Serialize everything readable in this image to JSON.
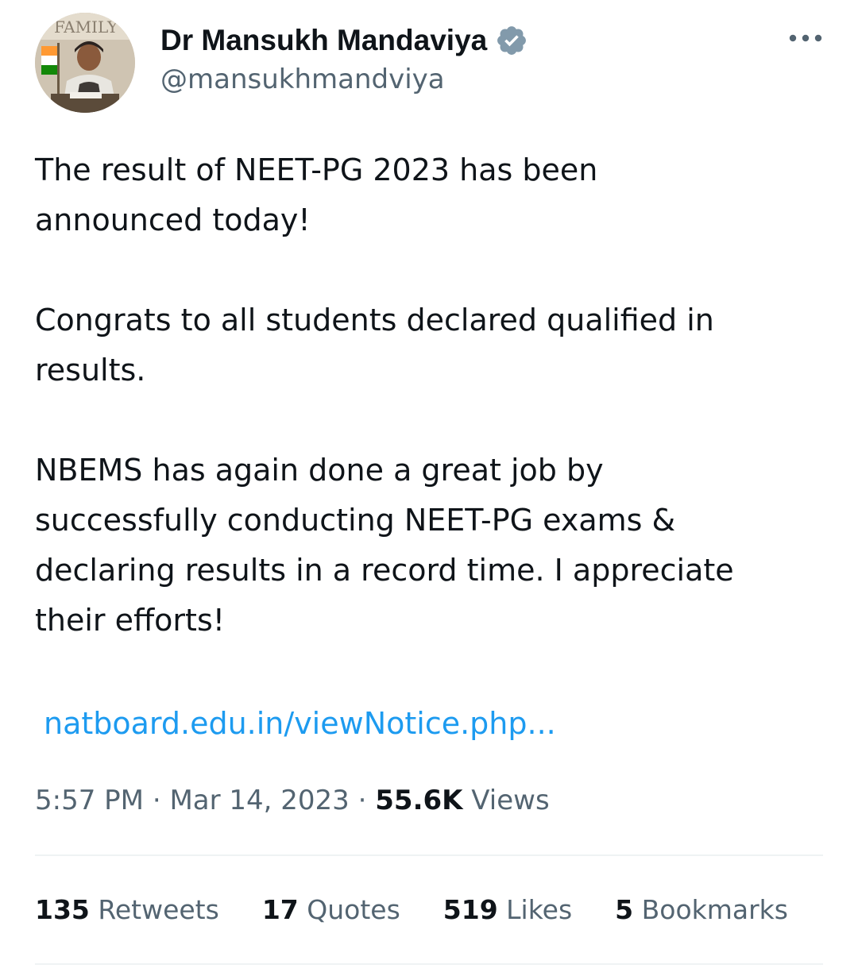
{
  "author": {
    "avatar_icon": "profile-photo",
    "avatar_text": "FAMILY",
    "display_name": "Dr Mansukh Mandaviya",
    "verified_icon": "verified-badge-icon",
    "handle": "@mansukhmandviya"
  },
  "menu": {
    "more_icon": "more-options-icon"
  },
  "tweet": {
    "paragraphs": [
      {
        "lines": [
          "The result of NEET-PG 2023 has been",
          "announced today!"
        ]
      },
      {
        "lines": [
          "Congrats to all students declared qualified in",
          "results."
        ]
      },
      {
        "lines": [
          "NBEMS has again done a great job by",
          "successfully conducting NEET-PG exams &",
          "declaring results in a record time. I appreciate",
          "their efforts!"
        ]
      }
    ],
    "link": "natboard.edu.in/viewNotice.php..."
  },
  "meta": {
    "time": "5:57 PM",
    "separator": "·",
    "date": "Mar 14, 2023",
    "views_count": "55.6K",
    "views_label": "Views"
  },
  "stats": [
    {
      "count": "135",
      "label": "Retweets"
    },
    {
      "count": "17",
      "label": "Quotes"
    },
    {
      "count": "519",
      "label": "Likes"
    },
    {
      "count": "5",
      "label": "Bookmarks"
    }
  ],
  "colors": {
    "text_primary": "#0f1419",
    "text_secondary": "#536471",
    "link": "#1d9bf0",
    "verified": "#829aab",
    "divider": "#eff3f4"
  }
}
